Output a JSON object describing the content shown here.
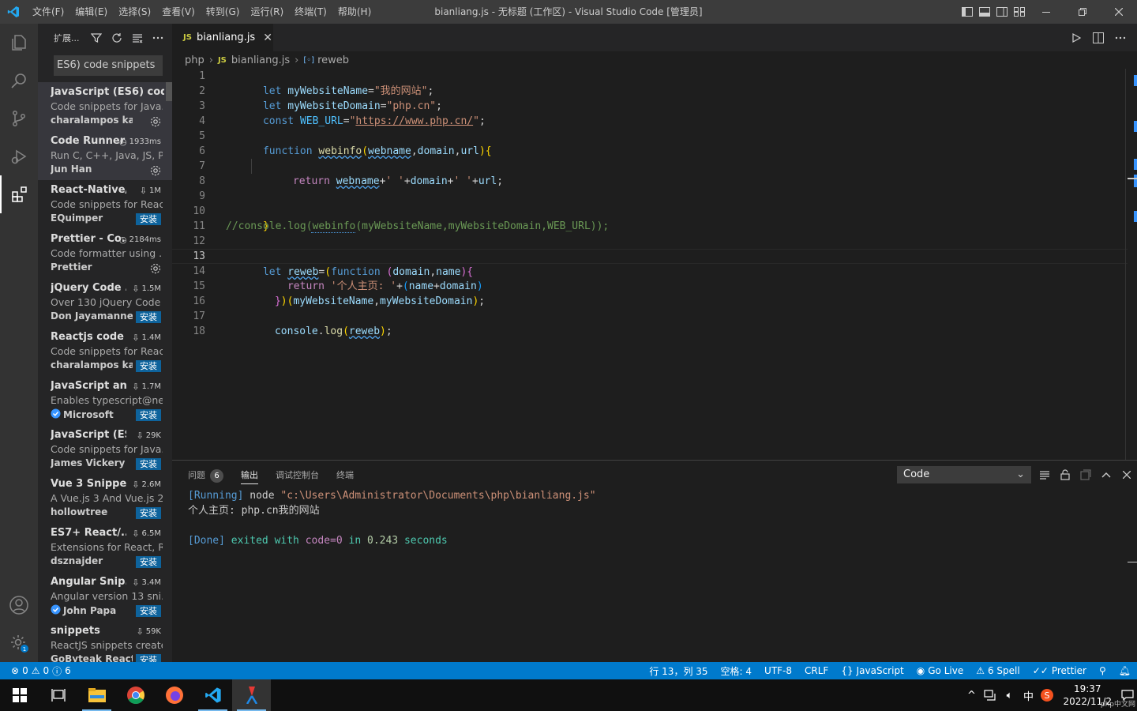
{
  "titlebar": {
    "menu": [
      "文件(F)",
      "编辑(E)",
      "选择(S)",
      "查看(V)",
      "转到(G)",
      "运行(R)",
      "终端(T)",
      "帮助(H)"
    ],
    "title": "bianliang.js - 无标题 (工作区) - Visual Studio Code [管理员]"
  },
  "sidebar": {
    "title": "扩展...",
    "search_value": "ES6) code snippets",
    "install_label": "安装",
    "extensions": [
      {
        "name": "JavaScript (ES6) code...",
        "stat": "",
        "desc": "Code snippets for Java...",
        "publisher": "charalampos karypi...",
        "action": "gear",
        "selected": true,
        "verified": false
      },
      {
        "name": "Code Runner",
        "stat": "1933ms",
        "stat_icon": "clock",
        "desc": "Run C, C++, Java, JS, P...",
        "publisher": "Jun Han",
        "action": "gear",
        "selected": true,
        "verified": false
      },
      {
        "name": "React-Native/...",
        "stat": "1M",
        "stat_icon": "cloud",
        "desc": "Code snippets for Reac...",
        "publisher": "EQuimper",
        "action": "install",
        "verified": false
      },
      {
        "name": "Prettier - Co...",
        "stat": "2184ms",
        "stat_icon": "clock",
        "desc": "Code formatter using ...",
        "publisher": "Prettier",
        "action": "gear",
        "verified": false
      },
      {
        "name": "jQuery Code ...",
        "stat": "1.5M",
        "stat_icon": "cloud",
        "desc": "Over 130 jQuery Code ...",
        "publisher": "Don Jayamanne",
        "action": "install",
        "verified": false
      },
      {
        "name": "Reactjs code ...",
        "stat": "1.4M",
        "stat_icon": "cloud",
        "desc": "Code snippets for Reac...",
        "publisher": "charalampos kar...",
        "action": "install",
        "verified": false
      },
      {
        "name": "JavaScript an...",
        "stat": "1.7M",
        "stat_icon": "cloud",
        "desc": "Enables typescript@ne...",
        "publisher": "Microsoft",
        "action": "install",
        "verified": true
      },
      {
        "name": "JavaScript (ES...",
        "stat": "29K",
        "stat_icon": "cloud",
        "desc": "Code snippets for Java...",
        "publisher": "James Vickery",
        "action": "install",
        "verified": false
      },
      {
        "name": "Vue 3 Snippets",
        "stat": "2.6M",
        "stat_icon": "cloud",
        "desc": "A Vue.js 3 And Vue.js 2...",
        "publisher": "hollowtree",
        "action": "install",
        "verified": false
      },
      {
        "name": "ES7+ React/...",
        "stat": "6.5M",
        "stat_icon": "cloud",
        "desc": "Extensions for React, R...",
        "publisher": "dsznajder",
        "action": "install",
        "verified": false
      },
      {
        "name": "Angular Snip...",
        "stat": "3.4M",
        "stat_icon": "cloud",
        "desc": "Angular version 13 sni...",
        "publisher": "John Papa",
        "action": "install",
        "verified": true
      },
      {
        "name": "snippets",
        "stat": "59K",
        "stat_icon": "cloud",
        "desc": "ReactJS snippets create...",
        "publisher": "GoByteak ReactJS...",
        "action": "install",
        "verified": false
      }
    ]
  },
  "editor": {
    "tab_label": "bianliang.js",
    "tab_lang": "JS",
    "breadcrumb": [
      "php",
      "bianliang.js",
      "reweb"
    ],
    "line_numbers": [
      "1",
      "2",
      "3",
      "4",
      "5",
      "6",
      "7",
      "8",
      "9",
      "10",
      "11",
      "12",
      "13",
      "14",
      "15",
      "16",
      "17",
      "18"
    ],
    "current_line": "13",
    "code": {
      "l1": [
        "let",
        " ",
        "myWebsiteName",
        "=",
        "\"我的网站\"",
        ";"
      ],
      "l2": [
        "let",
        " ",
        "myWebsiteDomain",
        "=",
        "\"php.cn\"",
        ";"
      ],
      "l3": [
        "const",
        " ",
        "WEB_URL",
        "=",
        "\"",
        "https://www.php.cn/",
        "\"",
        ";"
      ],
      "l5": [
        "function",
        " ",
        "webinfo",
        "(",
        "webname",
        ",",
        "domain",
        ",",
        "url",
        ")",
        "{"
      ],
      "l7": [
        "return",
        " ",
        "webname",
        "+",
        "' '",
        "+",
        "domain",
        "+",
        "' '",
        "+",
        "url",
        ";"
      ],
      "l10": [
        "}"
      ],
      "l11": "//console.log(webinfo(myWebsiteName,myWebsiteDomain,WEB_URL));",
      "l13": [
        "let",
        " ",
        "reweb",
        "=",
        "(",
        "function",
        " ",
        "(",
        "domain",
        ",",
        "name",
        ")",
        "{"
      ],
      "l14": [
        "return",
        " ",
        "'个人主页: '",
        "+",
        "(",
        "name",
        "+",
        "domain",
        ")"
      ],
      "l15": [
        "}",
        ")",
        "(",
        "myWebsiteName",
        ",",
        "myWebsiteDomain",
        ")",
        ";"
      ],
      "l17": [
        "console",
        ".",
        "log",
        "(",
        "reweb",
        ")",
        ";"
      ]
    }
  },
  "panel": {
    "tabs": [
      "问题",
      "输出",
      "调试控制台",
      "终端"
    ],
    "problems_count": "6",
    "channel": "Code",
    "output": {
      "running_tag": "[Running]",
      "running_cmd": " node ",
      "running_path": "\"c:\\Users\\Administrator\\Documents\\php\\bianliang.js\"",
      "result": "个人主页: php.cn我的网站",
      "done_tag": "[Done]",
      "done_exited": " exited with ",
      "done_code": "code=0",
      "done_in": " in ",
      "done_time": "0.243",
      "done_seconds": " seconds"
    }
  },
  "statusbar": {
    "errors": "0",
    "warnings": "0",
    "info": "6",
    "position": "行 13，列 35",
    "spaces": "空格: 4",
    "encoding": "UTF-8",
    "eol": "CRLF",
    "language": "JavaScript",
    "golive": "Go Live",
    "spell": "6 Spell",
    "prettier": "Prettier"
  },
  "taskbar": {
    "time": "19:37",
    "date": "2022/11/2",
    "ime": "中",
    "watermark": "php中文网"
  },
  "colors": {
    "accent": "#007acc",
    "install": "#0e639c",
    "activity_bar": "#333333",
    "sidebar": "#252526",
    "editor": "#1e1e1e"
  }
}
